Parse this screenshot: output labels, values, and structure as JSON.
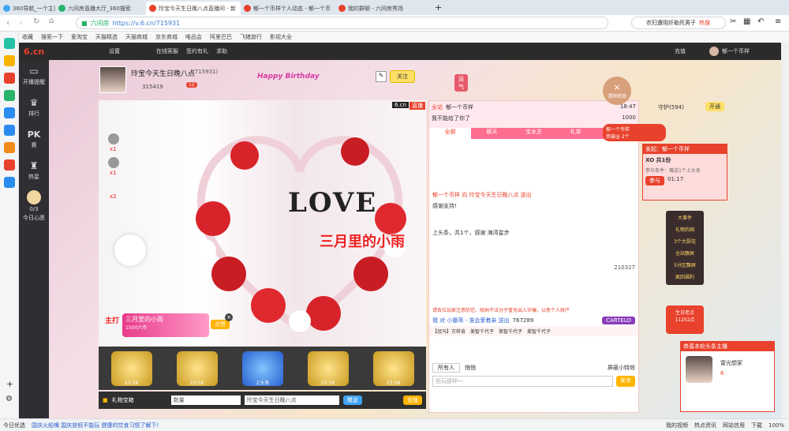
{
  "tabs": [
    {
      "label": "360导航_一个主页，整个世界",
      "color": "#3ea8f5"
    },
    {
      "label": "六间房直播大厅_360搜索",
      "color": "#27b36a"
    },
    {
      "label": "玲宝今天生日晚八点直播间 - 新",
      "color": "#e8412c"
    },
    {
      "label": "郁一个币样个人动态 - 郁一个币",
      "color": "#e8412c"
    },
    {
      "label": "我的群聊 - 六间房秀场",
      "color": "#e8412c"
    }
  ],
  "address": {
    "site": "六间房",
    "url": "https://v.6.cn/715931",
    "search_text": "农妇遭阻奸勒死男子",
    "hot": "热搜"
  },
  "bookmarks": [
    "收藏",
    "搜索一下",
    "爱淘宝",
    "天猫精选",
    "天猫商城",
    "京东商城",
    "唯品会",
    "阿里巴巴",
    "飞猪旅行",
    "影视大全"
  ],
  "topnav": {
    "logo": "6.cn",
    "settings": "设置",
    "items": [
      "在线客服",
      "签约有礼",
      "求助"
    ],
    "recharge": "充值",
    "user": "郁一个币样"
  },
  "sidenav": [
    {
      "label": "开播提醒"
    },
    {
      "label": "排行"
    },
    {
      "label": "PK",
      "sub": "赛"
    },
    {
      "label": "热星"
    },
    {
      "label": "0/3",
      "sub": "今日心愿"
    }
  ],
  "anchor": {
    "name": "玲宝今天生日晚八点",
    "id": "(715931)",
    "fans": "315419",
    "follow": "关注",
    "badge": "12",
    "birthday_tag": "Happy Birthday",
    "prize": "运气"
  },
  "video": {
    "site_tag": "6.cn",
    "live": "直播",
    "title_overlay": "三月里的小雨",
    "love": "LOVE",
    "x1": "x1",
    "x1b": "x1",
    "x2": "x2",
    "rank_badge": "主打"
  },
  "marquee": {
    "main": "三月里的小雨",
    "sub": "1500六币",
    "btn": "点赞"
  },
  "gifts": [
    {
      "name": "23:58",
      "sub": "郁一个币样"
    },
    {
      "name": "23:58",
      "sub": "郁一个币样"
    },
    {
      "name": "上头条",
      "sub": "郁一个币样"
    },
    {
      "name": "23:58",
      "sub": "郁一个币样"
    },
    {
      "name": "23:58",
      "sub": "郁一个币样"
    }
  ],
  "bottombar": {
    "gift_label": "礼物宝箱",
    "qty": "数量",
    "target": "玲宝今天生日晚八点",
    "send": "赠送",
    "recharge": "充值"
  },
  "chat": {
    "header": [
      {
        "tag": "全站",
        "text": "郁一个币样",
        "right": "18:47"
      },
      {
        "tag": "",
        "text": "我不能给了你了",
        "right": "1000"
      }
    ],
    "tabs": [
      "全部",
      "聊天",
      "宝水芝",
      "礼单",
      "活动"
    ],
    "messages": [
      "郁一个币样 向 玲宝今天生日晚八点 送出",
      "感谢支持!",
      "上头条，共1个，感谢 海湾星步",
      "清屏",
      "送屏"
    ],
    "car_label": "210327",
    "car_label2": "21032",
    "announce": "请各位玩家注意防范、吸纳不法分子冒充出入诈骗，以免个人财产",
    "rank_line": "我 对 小霸哥 - 准会爱着亲 送出",
    "rank_num": "767289",
    "rank_btn": "CARTELO",
    "names": [
      "【冠马】万样肯",
      "美智千代子",
      "美智千代子",
      "美智千代子"
    ],
    "chat_all": "所有人",
    "whisper": "悄悄",
    "hint": "悄悄",
    "input_placeholder": "但玩那样～",
    "send": "发言",
    "screen_lock": "屏蔽小特效"
  },
  "right": {
    "clear": "清除特效",
    "guard": "守护(594)",
    "open": "开通",
    "activity": "发起：郁一个币样",
    "xo": "XO 共1份",
    "xo_sub": "参与条件：赠送1个上头条",
    "join": "参与",
    "time": "01:17",
    "menu": [
      "大事件",
      "礼物的国",
      "3个大厨花",
      "全站飘屏",
      "5分区飘屏",
      "疯回福利"
    ],
    "star_label": "生日老点",
    "star_num": "11252点",
    "promo": "恭喜本轮头条主播",
    "promo_name": "雷光想家",
    "promo_num": "6",
    "live_pill": "郁一个币样",
    "live_pill_sub": "我被@ 2个"
  },
  "footer": [
    "今日优选",
    "国庆火船嘴 国庆放假不能玩 健康的饮食习惯了解下!",
    "我的视频",
    "热点资讯",
    "网站信用",
    "下载",
    "100%"
  ]
}
